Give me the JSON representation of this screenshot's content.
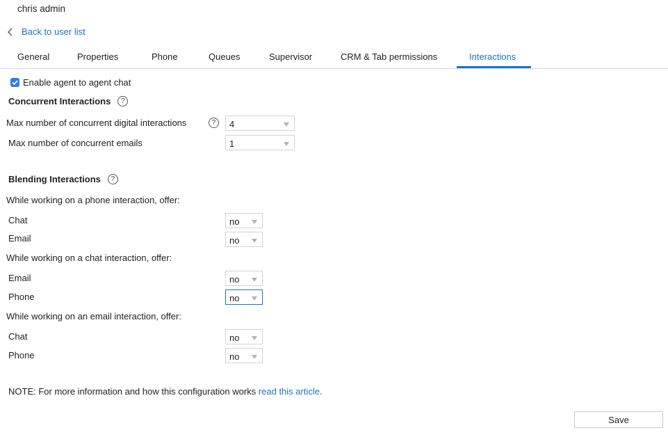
{
  "header": {
    "user_name": "chris admin",
    "back_label": "Back to user list"
  },
  "tabs": [
    {
      "label": "General"
    },
    {
      "label": "Properties"
    },
    {
      "label": "Phone"
    },
    {
      "label": "Queues"
    },
    {
      "label": "Supervisor"
    },
    {
      "label": "CRM & Tab permissions"
    },
    {
      "label": "Interactions",
      "active": true
    }
  ],
  "agent_chat": {
    "label": "Enable agent to agent chat",
    "checked": true
  },
  "concurrent": {
    "title": "Concurrent Interactions",
    "help_glyph": "?",
    "digital_label": "Max number of concurrent digital interactions",
    "digital_value": "4",
    "emails_label": "Max number of concurrent emails",
    "emails_value": "1"
  },
  "blending": {
    "title": "Blending Interactions",
    "help_glyph": "?",
    "phone_heading": "While working on a phone interaction, offer:",
    "phone_chat_label": "Chat",
    "phone_chat_value": "no",
    "phone_email_label": "Email",
    "phone_email_value": "no",
    "chat_heading": "While working on a chat interaction, offer:",
    "chat_email_label": "Email",
    "chat_email_value": "no",
    "chat_phone_label": "Phone",
    "chat_phone_value": "no",
    "email_heading": "While working on an email interaction, offer:",
    "email_chat_label": "Chat",
    "email_chat_value": "no",
    "email_phone_label": "Phone",
    "email_phone_value": "no"
  },
  "note": {
    "text": "NOTE: For more information and how this configuration works ",
    "link": "read this article",
    "suffix": "."
  },
  "actions": {
    "save_label": "Save"
  },
  "colors": {
    "accent": "#1a73c7",
    "checkbox": "#2f7de1"
  }
}
